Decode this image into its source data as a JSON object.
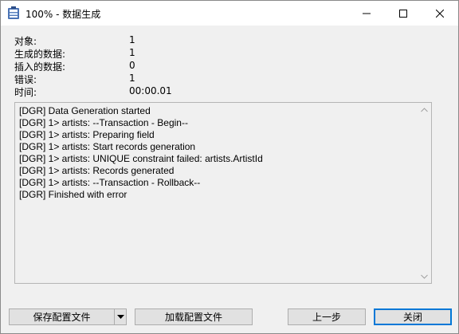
{
  "window": {
    "title": "100% - 数据生成",
    "icon": "database-generator-icon"
  },
  "stats": [
    {
      "label": "对象:",
      "value": "1"
    },
    {
      "label": "生成的数据:",
      "value": "1"
    },
    {
      "label": "插入的数据:",
      "value": "0"
    },
    {
      "label": "错误:",
      "value": "1"
    },
    {
      "label": "时间:",
      "value": "00:00.01"
    }
  ],
  "log": [
    "[DGR] Data Generation started",
    "[DGR] 1> artists: --Transaction - Begin--",
    "[DGR] 1> artists: Preparing field",
    "[DGR] 1> artists: Start records generation",
    "[DGR] 1> artists: UNIQUE constraint failed: artists.ArtistId",
    "[DGR] 1> artists: Records generated",
    "[DGR] 1> artists: --Transaction - Rollback--",
    "[DGR] Finished with error"
  ],
  "buttons": {
    "save_config": "保存配置文件",
    "load_config": "加载配置文件",
    "prev": "上一步",
    "close": "关闭"
  },
  "colors": {
    "accent": "#0078d7",
    "window_bg": "#f0f0f0",
    "button_bg": "#e1e1e1"
  }
}
